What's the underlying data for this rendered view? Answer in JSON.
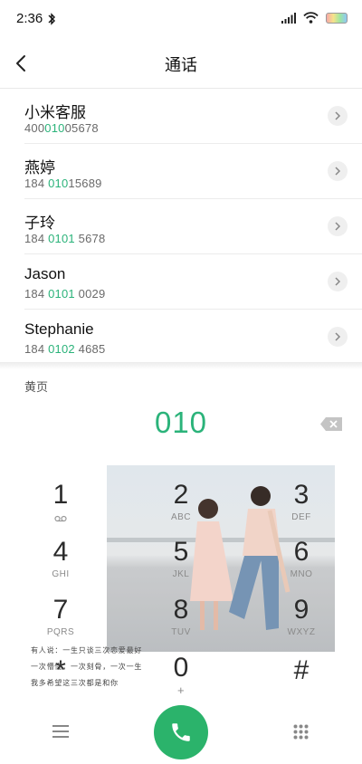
{
  "status_bar": {
    "time": "2:36"
  },
  "header": {
    "title": "通话"
  },
  "contacts": [
    {
      "name": "小米客服",
      "number_pre": "400",
      "number_hl": "010",
      "number_post": "05678"
    },
    {
      "name": "燕婷",
      "number_pre": "184 ",
      "number_hl": "010",
      "number_post": "15689"
    },
    {
      "name": "子玲",
      "number_pre": "184 ",
      "number_hl": "0101",
      "number_post": " 5678"
    },
    {
      "name": "Jason",
      "number_pre": "184 ",
      "number_hl": "0101",
      "number_post": " 0029"
    },
    {
      "name": "Stephanie",
      "number_pre": "184 ",
      "number_hl": "0102",
      "number_post": " 4685"
    }
  ],
  "yellow_pages_label": "黄页",
  "dial": {
    "input": "010"
  },
  "keypad": [
    {
      "digit": "1",
      "letters": ""
    },
    {
      "digit": "2",
      "letters": "ABC"
    },
    {
      "digit": "3",
      "letters": "DEF"
    },
    {
      "digit": "4",
      "letters": "GHI"
    },
    {
      "digit": "5",
      "letters": "JKL"
    },
    {
      "digit": "6",
      "letters": "MNO"
    },
    {
      "digit": "7",
      "letters": "PQRS"
    },
    {
      "digit": "8",
      "letters": "TUV"
    },
    {
      "digit": "9",
      "letters": "WXYZ"
    },
    {
      "digit": "0",
      "letters": "+"
    },
    {
      "digit": "*",
      "letters": ""
    },
    {
      "digit": "#",
      "letters": ""
    }
  ],
  "poem_lines": [
    "有人说：一生只谈三次恋爱最好",
    "一次懵懂，一次刻骨，一次一生",
    "我多希望这三次都是和你"
  ],
  "colors": {
    "accent": "#2bb37a",
    "call_button": "#2bb36b"
  },
  "icons": [
    "bluetooth-icon",
    "signal-icon",
    "wifi-icon",
    "battery-icon",
    "back-icon",
    "chevron-right-icon",
    "delete-icon",
    "voicemail-icon",
    "menu-icon",
    "phone-icon",
    "keypad-icon"
  ]
}
